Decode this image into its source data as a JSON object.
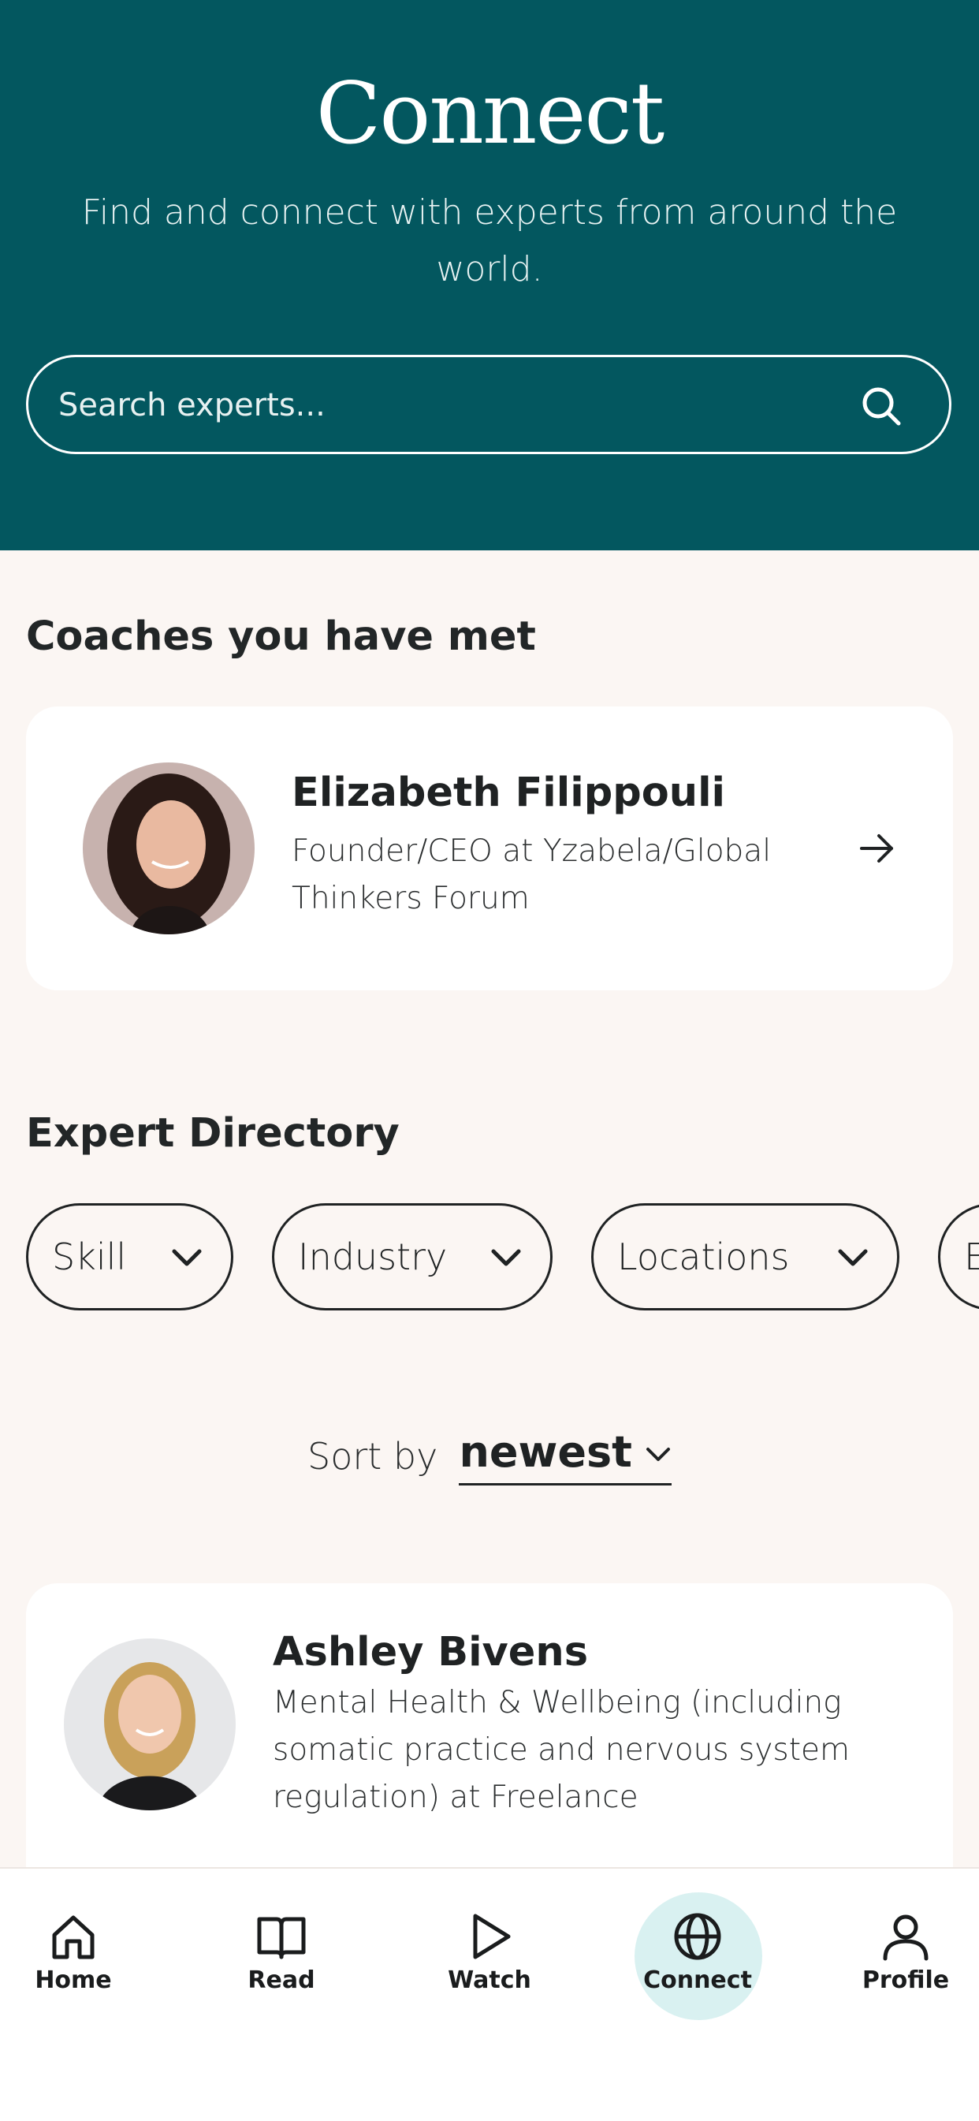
{
  "header": {
    "title": "Connect",
    "subtitle": "Find and connect with experts from around the world.",
    "search_placeholder": "Search experts...",
    "icon": "search-icon"
  },
  "met_section": {
    "title": "Coaches you have met",
    "coach": {
      "name": "Elizabeth Filippouli",
      "role": "Founder/CEO at Yzabela/Global Thinkers Forum",
      "icon": "arrow-right-icon"
    }
  },
  "directory": {
    "title": "Expert Directory",
    "filters": [
      "Skill",
      "Industry",
      "Locations",
      "E"
    ],
    "sort_label": "Sort by",
    "sort_value": "newest",
    "experts": [
      {
        "name": "Ashley Bivens",
        "role": "Mental Health & Wellbeing (including somatic practice and nervous system regulation) at Freelance"
      }
    ]
  },
  "tabbar": {
    "items": [
      {
        "label": "Home",
        "icon": "home-icon"
      },
      {
        "label": "Read",
        "icon": "book-icon"
      },
      {
        "label": "Watch",
        "icon": "play-icon"
      },
      {
        "label": "Connect",
        "icon": "globe-icon"
      },
      {
        "label": "Profile",
        "icon": "person-icon"
      }
    ],
    "active": "Connect"
  },
  "colors": {
    "hero": "#03575f",
    "background": "#fbf6f3",
    "card": "#ffffff",
    "active_tab": "#d9f1f1"
  }
}
